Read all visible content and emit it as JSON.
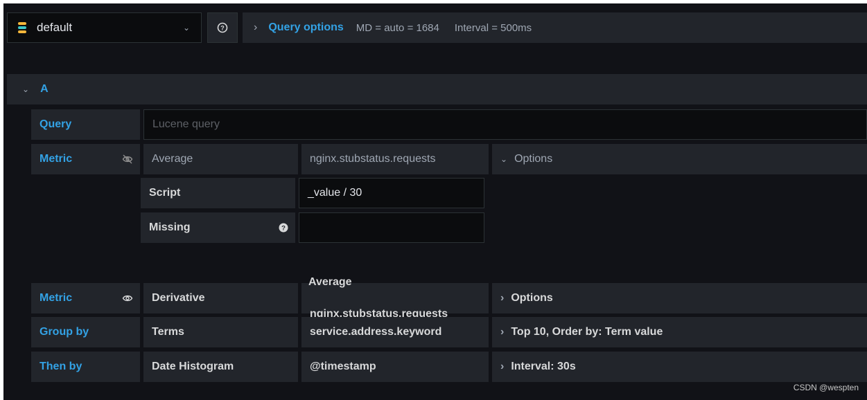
{
  "toolbar": {
    "datasource": "default",
    "query_options_label": "Query options",
    "md_text": "MD = auto = 1684",
    "interval_text": "Interval = 500ms"
  },
  "query_row": {
    "letter": "A"
  },
  "query": {
    "label": "Query",
    "placeholder": "Lucene query"
  },
  "metric1": {
    "label": "Metric",
    "agg": "Average",
    "field": "nginx.stubstatus.requests",
    "options_label": "Options",
    "script_label": "Script",
    "script_value": "_value / 30",
    "missing_label": "Missing",
    "missing_value": ""
  },
  "metric2": {
    "label": "Metric",
    "agg": "Derivative",
    "source_line1": "Average",
    "source_line2": "nginx.stubstatus.requests",
    "options_label": "Options"
  },
  "group_by": {
    "label": "Group by",
    "agg": "Terms",
    "field": "service.address.keyword",
    "options_label": "Top 10, Order by: Term value"
  },
  "then_by": {
    "label": "Then by",
    "agg": "Date Histogram",
    "field": "@timestamp",
    "options_label": "Interval: 30s"
  },
  "watermark": "CSDN @wespten"
}
